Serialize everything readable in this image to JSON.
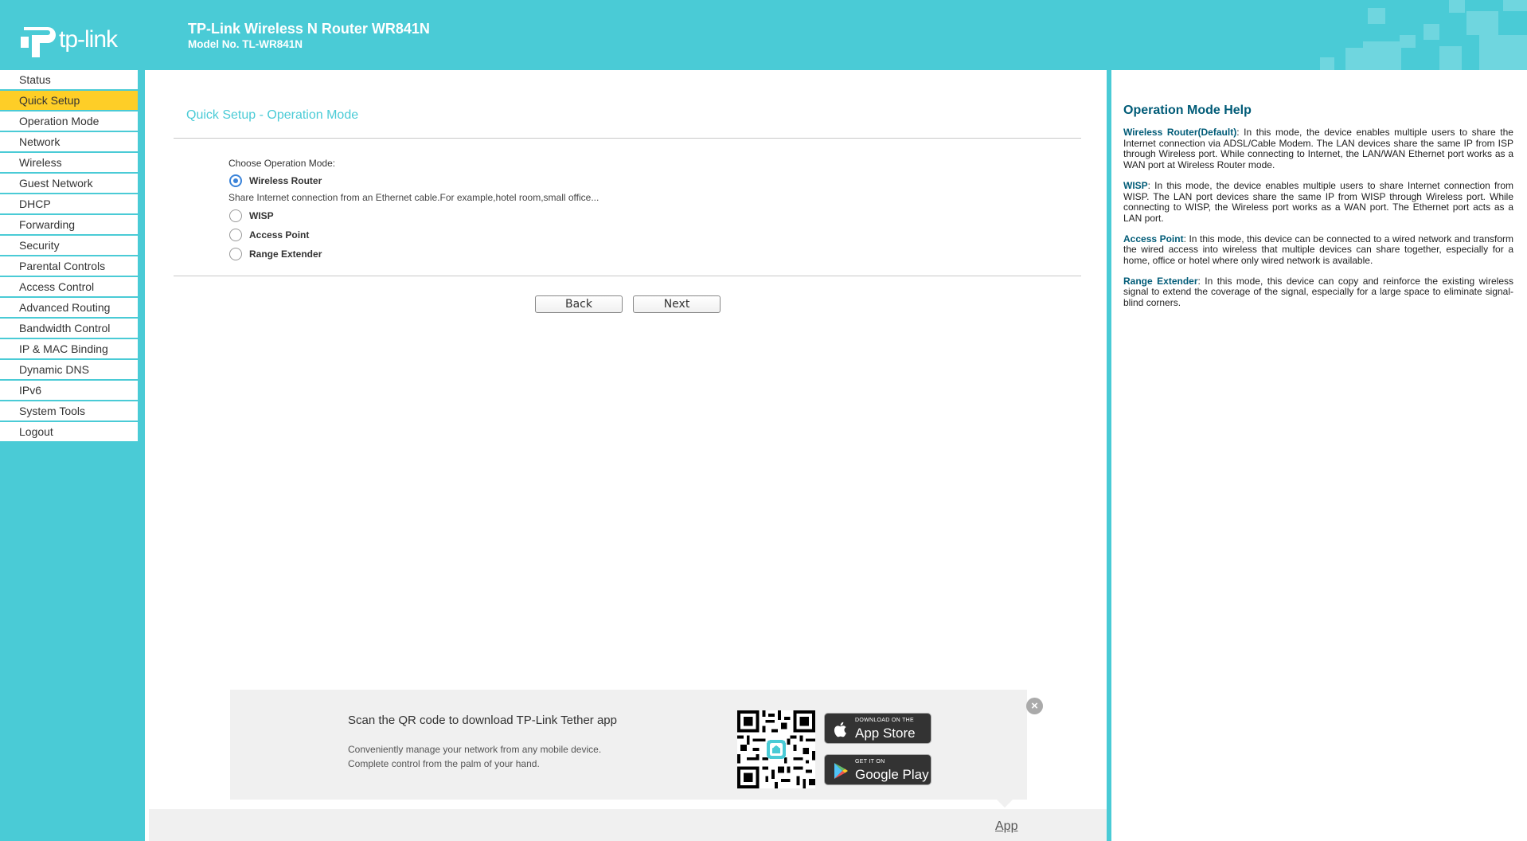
{
  "header": {
    "logo_text": "tp-link",
    "title": "TP-Link Wireless N Router WR841N",
    "model": "Model No. TL-WR841N"
  },
  "sidebar": {
    "items": [
      {
        "label": "Status"
      },
      {
        "label": "Quick Setup",
        "active": true
      },
      {
        "label": "Operation Mode"
      },
      {
        "label": "Network"
      },
      {
        "label": "Wireless"
      },
      {
        "label": "Guest Network"
      },
      {
        "label": "DHCP"
      },
      {
        "label": "Forwarding"
      },
      {
        "label": "Security"
      },
      {
        "label": "Parental Controls"
      },
      {
        "label": "Access Control"
      },
      {
        "label": "Advanced Routing"
      },
      {
        "label": "Bandwidth Control"
      },
      {
        "label": "IP & MAC Binding"
      },
      {
        "label": "Dynamic DNS"
      },
      {
        "label": "IPv6"
      },
      {
        "label": "System Tools"
      },
      {
        "label": "Logout"
      }
    ]
  },
  "main": {
    "title": "Quick Setup - Operation Mode",
    "choose_label": "Choose Operation Mode:",
    "modes": [
      {
        "label": "Wireless Router",
        "checked": true
      },
      {
        "label": "WISP",
        "checked": false
      },
      {
        "label": "Access Point",
        "checked": false
      },
      {
        "label": "Range Extender",
        "checked": false
      }
    ],
    "mode_description": "Share Internet connection from an Ethernet cable.For example,hotel room,small office...",
    "back_label": "Back",
    "next_label": "Next"
  },
  "promo": {
    "title": "Scan the QR code to download TP-Link Tether app",
    "line1": "Conveniently manage your network from any mobile device.",
    "line2": "Complete control from the palm of your hand.",
    "app_store_small": "DOWNLOAD ON THE",
    "app_store_big": "App Store",
    "google_play_small": "GET IT ON",
    "google_play_big": "Google Play",
    "close_glyph": "×",
    "app_link": "App"
  },
  "help": {
    "title": "Operation Mode Help",
    "paragraphs": [
      {
        "term": "Wireless Router(Default)",
        "text": ": In this mode, the device enables multiple users to share the Internet connection via ADSL/Cable Modem. The LAN devices share the same IP from ISP through Wireless port. While connecting to Internet, the LAN/WAN Ethernet port works as a WAN port at Wireless Router mode."
      },
      {
        "term": "WISP",
        "text": ": In this mode, the device enables multiple users to share Internet connection from WISP. The LAN port devices share the same IP from WISP through Wireless port. While connecting to WISP, the Wireless port works as a WAN port. The Ethernet port acts as a LAN port."
      },
      {
        "term": "Access Point",
        "text": ": In this mode, this device can be connected to a wired network and transform the wired access into wireless that multiple devices can share together, especially for a home, office or hotel where only wired network is available."
      },
      {
        "term": "Range Extender",
        "text": ": In this mode, this device can copy and reinforce the existing wireless signal to extend the coverage of the signal, especially for a large space to eliminate signal-blind corners."
      }
    ]
  },
  "colors": {
    "brand_teal": "#4acbd6",
    "active_nav": "#fece27",
    "help_term": "#005b77"
  }
}
